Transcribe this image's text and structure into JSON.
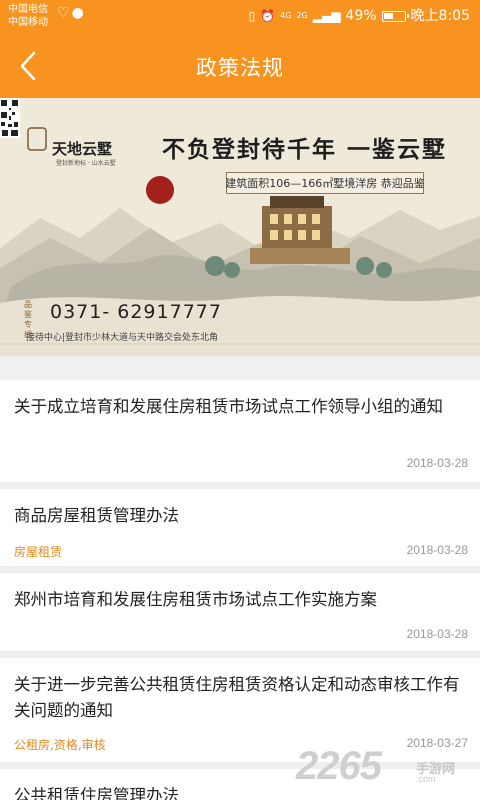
{
  "status_bar": {
    "carrier_1": "中国电信",
    "carrier_2": "中国移动",
    "network_1": "4G",
    "network_2": "2G",
    "battery_percent": "49%",
    "battery_level": 0.49,
    "time": "晚上8:05"
  },
  "header": {
    "title": "政策法规",
    "back_icon": "chevron-left-icon",
    "background": "#f7931e"
  },
  "banner": {
    "brand": "天地云墅",
    "brand_sub": "登封新地标 · 山水云墅",
    "slogan": "不负登封待千年 一鉴云墅",
    "area_text": "建筑面积106—166㎡墅境洋房 恭迎品鉴",
    "phone_tag": "品鉴专线",
    "phone": "0371- 62917777",
    "address": "接待中心|登封市少林大道与天中路交会处东北角"
  },
  "articles": [
    {
      "title": "关于成立培育和发展住房租赁市场试点工作领导小组的通知",
      "tags": "",
      "date": "2018-03-28"
    },
    {
      "title": "商品房屋租赁管理办法",
      "tags": "房屋租赁",
      "date": "2018-03-28"
    },
    {
      "title": "郑州市培育和发展住房租赁市场试点工作实施方案",
      "tags": "",
      "date": "2018-03-28"
    },
    {
      "title": "关于进一步完善公共租赁住房租赁资格认定和动态审核工作有关问题的通知",
      "tags": "公租房,资格,审核",
      "date": "2018-03-27"
    },
    {
      "title": "公共租赁住房管理办法",
      "tags": "",
      "date": ""
    }
  ],
  "watermark": {
    "number": "2265",
    "site": "手游网",
    "url": ".com"
  },
  "colors": {
    "accent": "#f7931e",
    "tag": "#e08a1e",
    "date": "#999999"
  }
}
